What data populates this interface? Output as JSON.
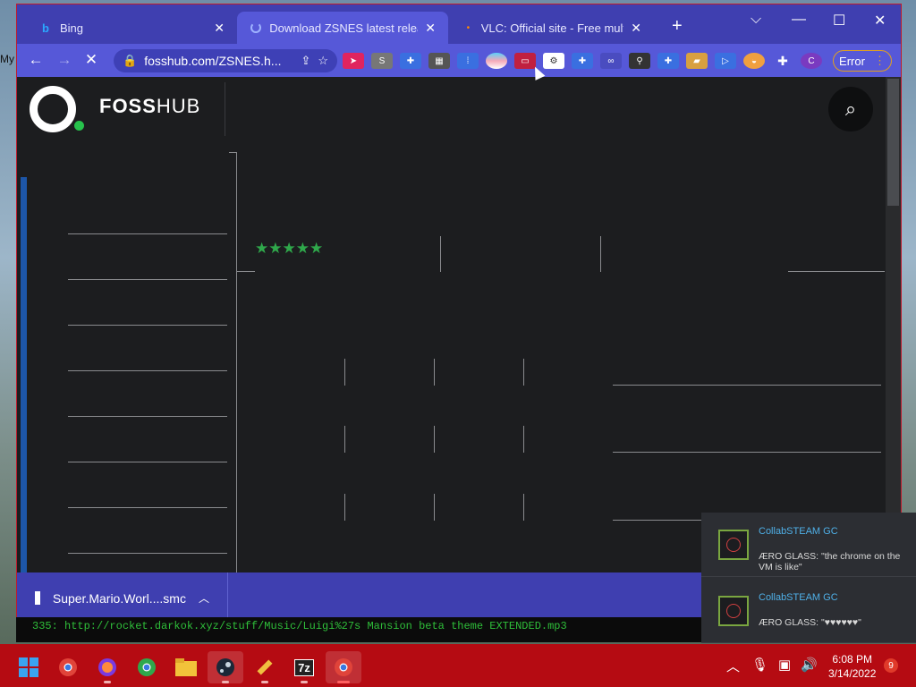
{
  "desktop": {
    "label": "My"
  },
  "browser": {
    "tabs": [
      {
        "title": "Bing",
        "icon": "bing-icon",
        "active": false
      },
      {
        "title": "Download ZSNES latest release",
        "icon": "loading-spinner-icon",
        "active": true
      },
      {
        "title": "VLC: Official site - Free multimedia",
        "icon": "vlc-icon",
        "active": false
      }
    ],
    "omnibox": {
      "url": "fosshub.com/ZSNES.h..."
    },
    "error_label": "Error",
    "extensions": [
      "pinned-ext-icon",
      "s-ext-icon",
      "puzzle-ext-icon",
      "grid-ext-icon",
      "apps-ext-icon",
      "flag-ext-icon",
      "monitor-ext-icon",
      "translate-ext-icon",
      "puzzle-ext-icon",
      "link-ext-icon",
      "stamp-ext-icon",
      "puzzle-ext-icon",
      "folder-ext-icon",
      "play-ext-icon",
      "fox-ext-icon",
      "extensions-icon",
      "profile-c-icon"
    ],
    "profile_letter": "C",
    "ext_letter": "S"
  },
  "page": {
    "brand_bold": "FOSS",
    "brand_light": "HUB",
    "rating_stars": "★★★★★"
  },
  "download": {
    "filename": "Super.Mario.Worl....smc"
  },
  "console": {
    "text": "335: http://rocket.darkok.xyz/stuff/Music/Luigi%27s Mansion beta theme EXTENDED.mp3"
  },
  "notifications": [
    {
      "title": "CollabSTEAM GC",
      "body": "ÆRO GLASS: \"the chrome on the VM is like\""
    },
    {
      "title": "CollabSTEAM GC",
      "body": "ÆRO GLASS: \"♥♥♥♥♥♥\""
    }
  ],
  "taskbar": {
    "apps": [
      "windows-start-icon",
      "chrome-icon",
      "firefox-icon",
      "chrome-icon",
      "file-explorer-icon",
      "steam-icon",
      "pencil-app-icon",
      "7zip-icon",
      "chrome-icon"
    ],
    "sevenzip_label": "7z",
    "time": "6:08 PM",
    "date": "3/14/2022",
    "notification_count": "9"
  },
  "colors": {
    "accent": "#5658d8",
    "tabbar": "#3f3fb0",
    "taskbar": "#b50b12",
    "stars": "#2fa84b"
  }
}
